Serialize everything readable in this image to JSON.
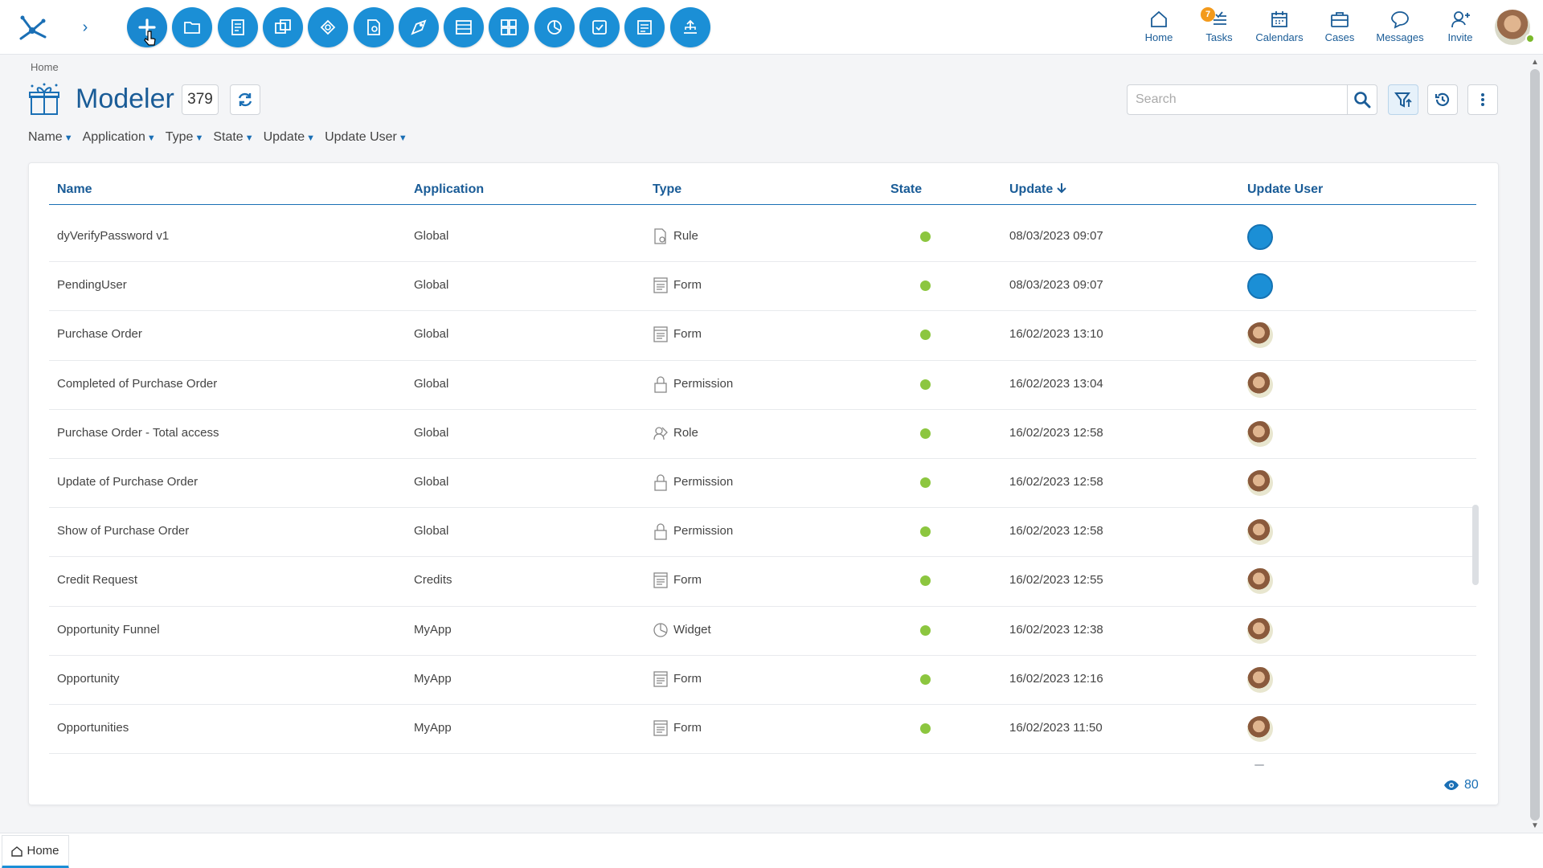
{
  "topbar": {
    "tools": [
      {
        "icon": "plus-icon"
      },
      {
        "icon": "folder-icon"
      },
      {
        "icon": "form-icon"
      },
      {
        "icon": "entities-icon"
      },
      {
        "icon": "roles-icon"
      },
      {
        "icon": "rule-icon"
      },
      {
        "icon": "process-icon"
      },
      {
        "icon": "app-icon"
      },
      {
        "icon": "dashboard-icon"
      },
      {
        "icon": "widget-icon"
      },
      {
        "icon": "task-icon"
      },
      {
        "icon": "report-icon"
      },
      {
        "icon": "publish-icon"
      }
    ],
    "nav": {
      "home": "Home",
      "tasks": "Tasks",
      "tasks_badge": "7",
      "calendars": "Calendars",
      "cases": "Cases",
      "messages": "Messages",
      "invite": "Invite"
    }
  },
  "header": {
    "breadcrumb": "Home",
    "title": "Modeler",
    "count": "379",
    "search_placeholder": "Search"
  },
  "filters": [
    "Name",
    "Application",
    "Type",
    "State",
    "Update",
    "Update User"
  ],
  "table": {
    "columns": {
      "name": "Name",
      "application": "Application",
      "type": "Type",
      "state": "State",
      "update": "Update",
      "update_user": "Update User"
    },
    "rows": [
      {
        "name": "dyVerifyPassword v1",
        "application": "Global",
        "type": "Rule",
        "type_icon": "rule-icon",
        "update": "08/03/2023 09:07",
        "user": "system"
      },
      {
        "name": "PendingUser",
        "application": "Global",
        "type": "Form",
        "type_icon": "form-icon",
        "update": "08/03/2023 09:07",
        "user": "system"
      },
      {
        "name": "Purchase Order",
        "application": "Global",
        "type": "Form",
        "type_icon": "form-icon",
        "update": "16/02/2023 13:10",
        "user": "person"
      },
      {
        "name": "Completed of Purchase Order",
        "application": "Global",
        "type": "Permission",
        "type_icon": "lock-icon",
        "update": "16/02/2023 13:04",
        "user": "person"
      },
      {
        "name": "Purchase Order - Total access",
        "application": "Global",
        "type": "Role",
        "type_icon": "role-icon",
        "update": "16/02/2023 12:58",
        "user": "person"
      },
      {
        "name": "Update of Purchase Order",
        "application": "Global",
        "type": "Permission",
        "type_icon": "lock-icon",
        "update": "16/02/2023 12:58",
        "user": "person"
      },
      {
        "name": "Show of Purchase Order",
        "application": "Global",
        "type": "Permission",
        "type_icon": "lock-icon",
        "update": "16/02/2023 12:58",
        "user": "person"
      },
      {
        "name": "Credit Request",
        "application": "Credits",
        "type": "Form",
        "type_icon": "form-icon",
        "update": "16/02/2023 12:55",
        "user": "person"
      },
      {
        "name": "Opportunity Funnel",
        "application": "MyApp",
        "type": "Widget",
        "type_icon": "widget-icon",
        "update": "16/02/2023 12:38",
        "user": "person"
      },
      {
        "name": "Opportunity",
        "application": "MyApp",
        "type": "Form",
        "type_icon": "form-icon",
        "update": "16/02/2023 12:16",
        "user": "person"
      },
      {
        "name": "Opportunities",
        "application": "MyApp",
        "type": "Form",
        "type_icon": "form-icon",
        "update": "16/02/2023 11:50",
        "user": "person"
      }
    ],
    "viewers": "80"
  },
  "bottombar": {
    "home_tab": "Home"
  },
  "colors": {
    "accent": "#1b8fd6",
    "title": "#1a5c97",
    "state_active": "#8cc63f",
    "badge": "#f39a1c"
  }
}
